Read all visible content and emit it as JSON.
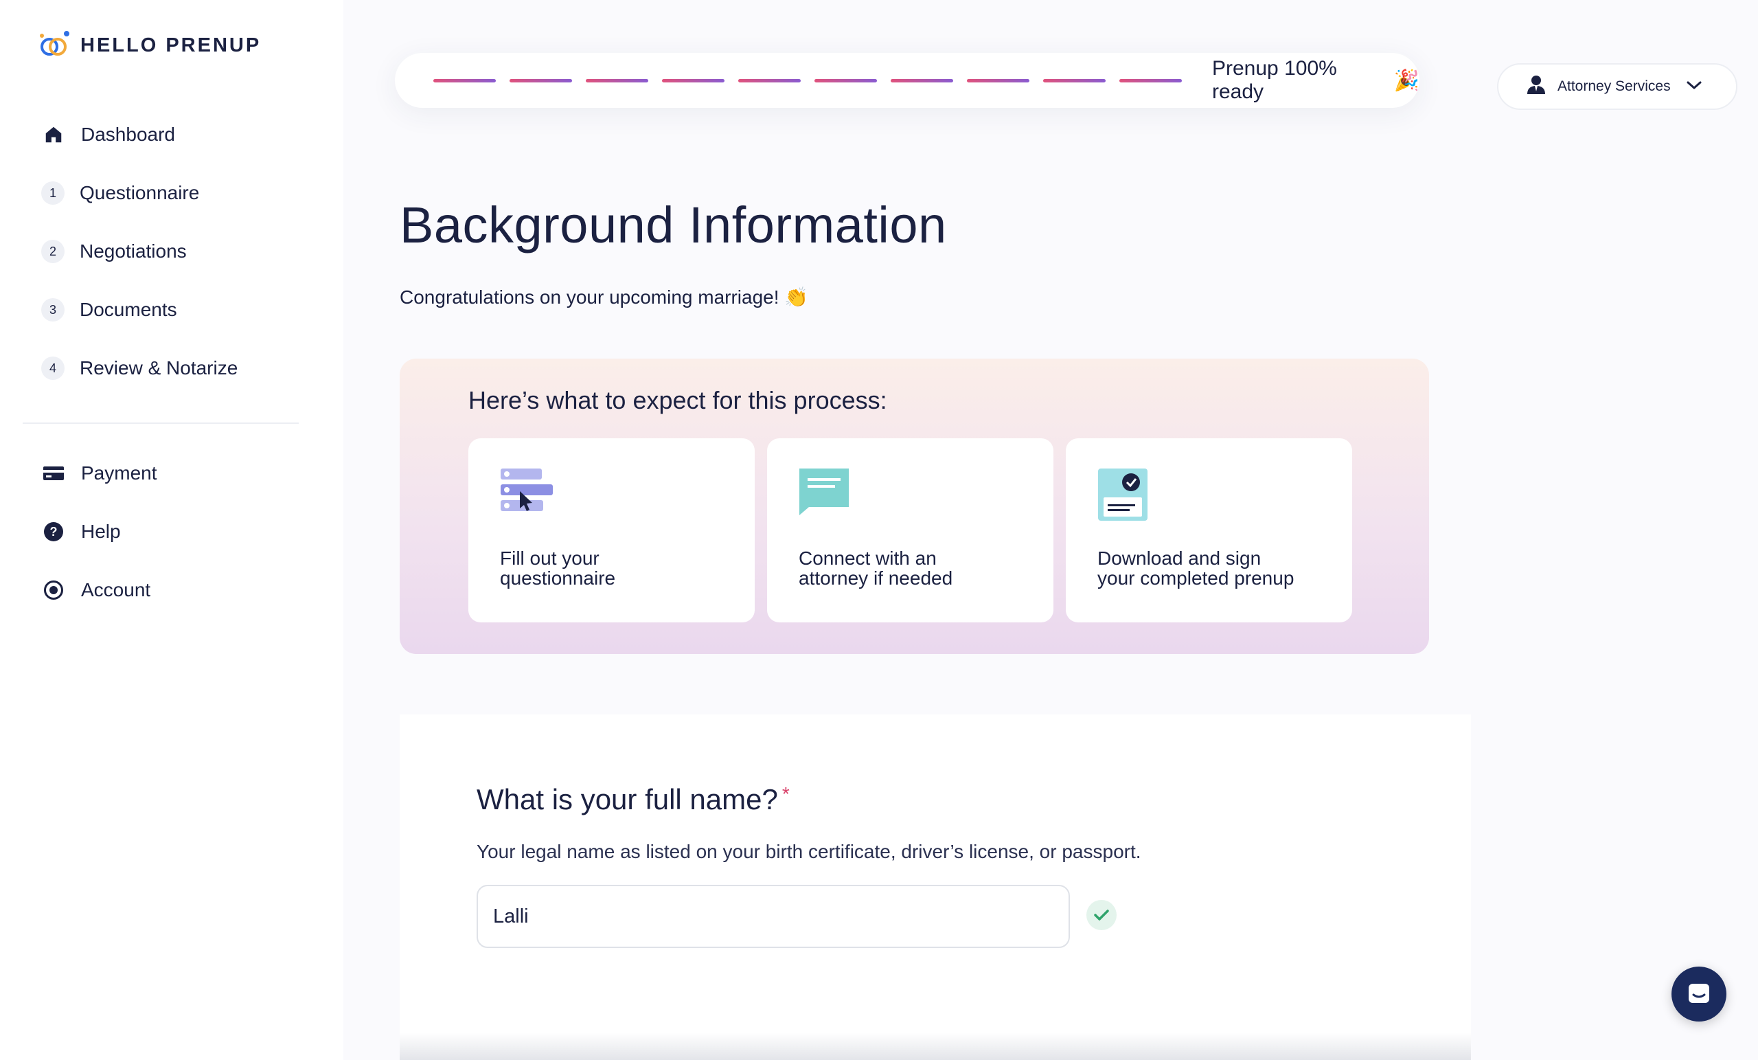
{
  "brand": {
    "name": "HELLO PRENUP",
    "logo_icon": "interlocked-rings-icon"
  },
  "sidebar": {
    "primary": [
      {
        "label": "Dashboard",
        "icon": "home-icon"
      },
      {
        "label": "Questionnaire",
        "step": "1"
      },
      {
        "label": "Negotiations",
        "step": "2"
      },
      {
        "label": "Documents",
        "step": "3"
      },
      {
        "label": "Review & Notarize",
        "step": "4"
      }
    ],
    "secondary": [
      {
        "label": "Payment",
        "icon": "credit-card-icon"
      },
      {
        "label": "Help",
        "icon": "help-circle-icon"
      },
      {
        "label": "Account",
        "icon": "account-circle-icon"
      }
    ]
  },
  "progress": {
    "segments": 10,
    "completed": 10,
    "label": "Prenup 100% ready",
    "emoji": "🎉"
  },
  "attorney_services": {
    "label": "Attorney Services"
  },
  "page": {
    "title": "Background Information",
    "subtitle": "Congratulations on your upcoming marriage! 👏"
  },
  "process": {
    "title": "Here’s what to expect for this process:",
    "steps": [
      {
        "line1": "Fill out your",
        "line2": "questionnaire",
        "icon": "form-cursor-icon"
      },
      {
        "line1": "Connect with an",
        "line2": "attorney if needed",
        "icon": "chat-bubble-icon"
      },
      {
        "line1": "Download and sign",
        "line2": "your completed prenup",
        "icon": "verified-document-icon"
      }
    ]
  },
  "question": {
    "title": "What is your full name?",
    "required_mark": "*",
    "help": "Your legal name as listed on your birth certificate, driver’s license, or passport.",
    "value": "Lalli",
    "valid": true
  },
  "colors": {
    "navy": "#1b2141",
    "progress_start": "#e0527c",
    "progress_end": "#8a5bd0",
    "valid_green": "#2fa36b",
    "chat_bg": "#1b2b5e"
  }
}
